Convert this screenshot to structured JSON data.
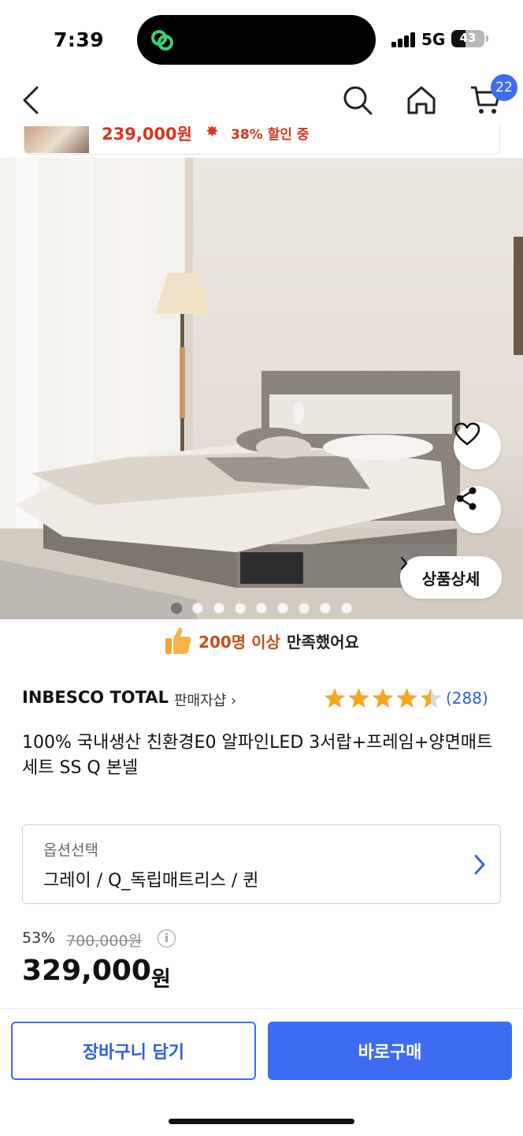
{
  "status_bar": {
    "time": "7:39",
    "network": "5G",
    "battery": "43",
    "battery_level": 0.43
  },
  "nav": {
    "cart_count": "22"
  },
  "sticky_strip": {
    "price": "239,000원",
    "discount": "38% 할인 중"
  },
  "gallery": {
    "detail_label": "상품상세",
    "dot_count": 9,
    "active_index": 0
  },
  "satisfaction": {
    "highlight": "200명 이상",
    "rest": "만족했어요"
  },
  "product": {
    "seller": "INBESCO TOTAL",
    "seller_link": "판매자샵",
    "rating": 4.5,
    "review_count": "(288)",
    "title": "100% 국내생산 친환경E0 알파인LED 3서랍+프레임+양면매트세트 SS Q 본넬"
  },
  "option": {
    "label": "옵션선택",
    "value": "그레이 / Q_독립매트리스 / 퀸"
  },
  "pricing": {
    "discount_rate": "53%",
    "original_price": "700,000원",
    "price": "329,000",
    "unit": "원"
  },
  "actions": {
    "cart": "장바구니 담기",
    "buy": "바로구매"
  },
  "colors": {
    "accent": "#3d6bf2",
    "sale": "#d8341e",
    "star": "#f5a623",
    "satisfaction": "#c4511a"
  }
}
